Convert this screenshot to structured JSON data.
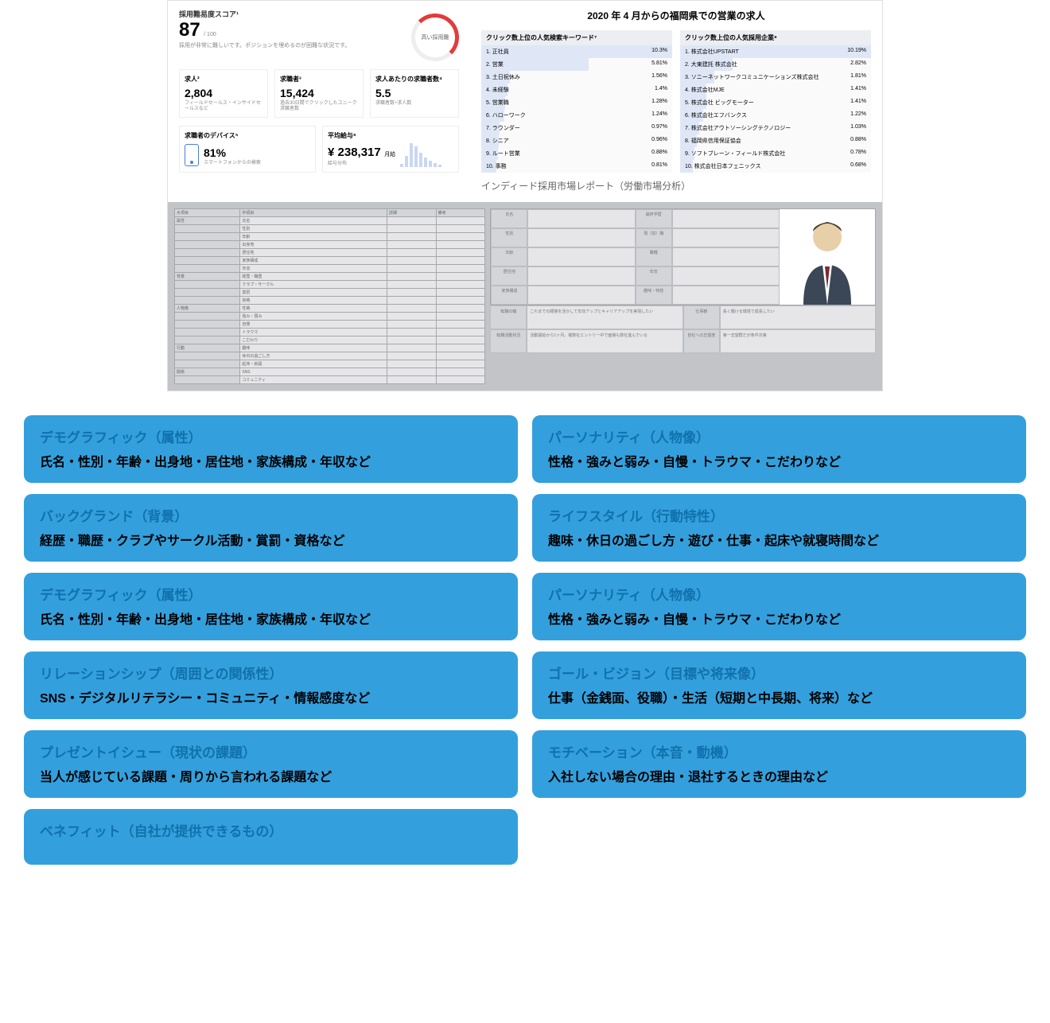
{
  "report": {
    "title": "2020 年 4 月からの福岡県での営業の求人",
    "caption": "インディード採用市場レポート（労働市場分析）",
    "score": {
      "label": "採用難易度スコア¹",
      "value": "87",
      "suffix": "/ 100",
      "note": "採用が非常に難しいです。ポジションを埋めるのが困難な状況です。",
      "donut": "高い採用難"
    },
    "metrics": [
      {
        "label": "求人²",
        "value": "2,804",
        "note": "フィールドセールス・インサイドセールスなど"
      },
      {
        "label": "求職者³",
        "value": "15,424",
        "note": "過去30日間でクリックしたユニーク求職者数"
      },
      {
        "label": "求人あたりの求職者数⁴",
        "value": "5.5",
        "note": "求職者数÷求人数"
      }
    ],
    "device": {
      "label": "求職者のデバイス⁵",
      "pct": "81%",
      "note": "スマートフォンからの検索"
    },
    "salary": {
      "label": "平均給与⁶",
      "value": "¥ 238,317",
      "unit": "月給",
      "bar_label": "給与分布"
    },
    "keywords": {
      "title": "クリック数上位の人気検索キーワード⁷",
      "items": [
        {
          "rank": "1.",
          "name": "正社員",
          "pct": "10.3%"
        },
        {
          "rank": "2.",
          "name": "営業",
          "pct": "5.81%"
        },
        {
          "rank": "3.",
          "name": "土日祝休み",
          "pct": "1.56%"
        },
        {
          "rank": "4.",
          "name": "未経験",
          "pct": "1.4%"
        },
        {
          "rank": "5.",
          "name": "営業職",
          "pct": "1.28%"
        },
        {
          "rank": "6.",
          "name": "ハローワーク",
          "pct": "1.24%"
        },
        {
          "rank": "7.",
          "name": "ラウンダー",
          "pct": "0.97%"
        },
        {
          "rank": "8.",
          "name": "シニア",
          "pct": "0.96%"
        },
        {
          "rank": "9.",
          "name": "ルート営業",
          "pct": "0.88%"
        },
        {
          "rank": "10.",
          "name": "事務",
          "pct": "0.81%"
        }
      ]
    },
    "companies": {
      "title": "クリック数上位の人気採用企業⁸",
      "items": [
        {
          "rank": "1.",
          "name": "株式会社UPSTART",
          "pct": "10.19%"
        },
        {
          "rank": "2.",
          "name": "大東建託 株式会社",
          "pct": "2.82%"
        },
        {
          "rank": "3.",
          "name": "ソニーネットワークコミュニケーションズ株式会社",
          "pct": "1.81%"
        },
        {
          "rank": "4.",
          "name": "株式会社MJE",
          "pct": "1.41%"
        },
        {
          "rank": "5.",
          "name": "株式会社 ビッグモーター",
          "pct": "1.41%"
        },
        {
          "rank": "6.",
          "name": "株式会社エフバンクス",
          "pct": "1.22%"
        },
        {
          "rank": "7.",
          "name": "株式会社アウトソーシングテクノロジー",
          "pct": "1.03%"
        },
        {
          "rank": "8.",
          "name": "福岡県信用保証協会",
          "pct": "0.88%"
        },
        {
          "rank": "9.",
          "name": "ソフトブレーン・フィールド株式会社",
          "pct": "0.78%"
        },
        {
          "rank": "10.",
          "name": "株式会社日本フェニックス",
          "pct": "0.68%"
        }
      ]
    }
  },
  "sheet": {
    "header_row": [
      "大項目",
      "中項目",
      "詳細",
      "備考"
    ],
    "rows": [
      [
        "属性",
        "氏名",
        "",
        ""
      ],
      [
        "",
        "性別",
        "",
        ""
      ],
      [
        "",
        "年齢",
        "",
        ""
      ],
      [
        "",
        "出身地",
        "",
        ""
      ],
      [
        "",
        "居住地",
        "",
        ""
      ],
      [
        "",
        "家族構成",
        "",
        ""
      ],
      [
        "",
        "年収",
        "",
        ""
      ],
      [
        "背景",
        "経歴・職歴",
        "",
        ""
      ],
      [
        "",
        "クラブ・サークル",
        "",
        ""
      ],
      [
        "",
        "賞罰",
        "",
        ""
      ],
      [
        "",
        "資格",
        "",
        ""
      ],
      [
        "人物像",
        "性格",
        "",
        ""
      ],
      [
        "",
        "強み・弱み",
        "",
        ""
      ],
      [
        "",
        "自慢",
        "",
        ""
      ],
      [
        "",
        "トラウマ",
        "",
        ""
      ],
      [
        "",
        "こだわり",
        "",
        ""
      ],
      [
        "行動",
        "趣味",
        "",
        ""
      ],
      [
        "",
        "休日の過ごし方",
        "",
        ""
      ],
      [
        "",
        "起床・就寝",
        "",
        ""
      ],
      [
        "関係",
        "SNS",
        "",
        ""
      ],
      [
        "",
        "コミュニティ",
        "",
        ""
      ]
    ]
  },
  "persona": {
    "rows": [
      [
        "氏名",
        "",
        "最終学歴",
        ""
      ],
      [
        "性別",
        "",
        "現（前）職",
        ""
      ],
      [
        "年齢",
        "",
        "職種",
        ""
      ],
      [
        "居住地",
        "",
        "年収",
        ""
      ],
      [
        "家族構成",
        "",
        "趣味・特技",
        ""
      ]
    ],
    "lower": [
      [
        "転職の軸",
        "これまでの経験を活かして年収アップとキャリアアップを実現したい",
        "仕事観",
        "長く働ける環境で成長したい"
      ],
      [
        "転職活動状況",
        "活動開始から1ヶ月。複数社エントリー中で面接も数社進んでいる",
        "自社への志望度",
        "第一志望群だが条件次第"
      ]
    ]
  },
  "cards": [
    {
      "title": "デモグラフィック（属性）",
      "body": "氏名・性別・年齢・出身地・居住地・家族構成・年収など"
    },
    {
      "title": "パーソナリティ（人物像）",
      "body": "性格・強みと弱み・自慢・トラウマ・こだわりなど"
    },
    {
      "title": "バックグランド（背景）",
      "body": "経歴・職歴・クラブやサークル活動・賞罰・資格など"
    },
    {
      "title": "ライフスタイル（行動特性）",
      "body": "趣味・休日の過ごし方・遊び・仕事・起床や就寝時間など"
    },
    {
      "title": "デモグラフィック（属性）",
      "body": "氏名・性別・年齢・出身地・居住地・家族構成・年収など"
    },
    {
      "title": "パーソナリティ（人物像）",
      "body": "性格・強みと弱み・自慢・トラウマ・こだわりなど"
    },
    {
      "title": "リレーションシップ（周囲との関係性）",
      "body": "SNS・デジタルリテラシー・コミュニティ・情報感度など"
    },
    {
      "title": "ゴール・ビジョン（目標や将来像）",
      "body": "仕事（金銭面、役職）・生活（短期と中長期、将来）など"
    },
    {
      "title": "プレゼントイシュー（現状の課題）",
      "body": "当人が感じている課題・周りから言われる課題など"
    },
    {
      "title": "モチベーション（本音・動機）",
      "body": "入社しない場合の理由・退社するときの理由など"
    },
    {
      "title": "ベネフィット（自社が提供できるもの）",
      "body": ""
    }
  ],
  "chart_data": {
    "type": "bar",
    "title": "給与分布",
    "xlabel": "",
    "ylabel": "",
    "categories": [
      "",
      "",
      "",
      "",
      "",
      "",
      "",
      "",
      ""
    ],
    "values": [
      4,
      14,
      30,
      26,
      18,
      12,
      8,
      5,
      3
    ]
  }
}
